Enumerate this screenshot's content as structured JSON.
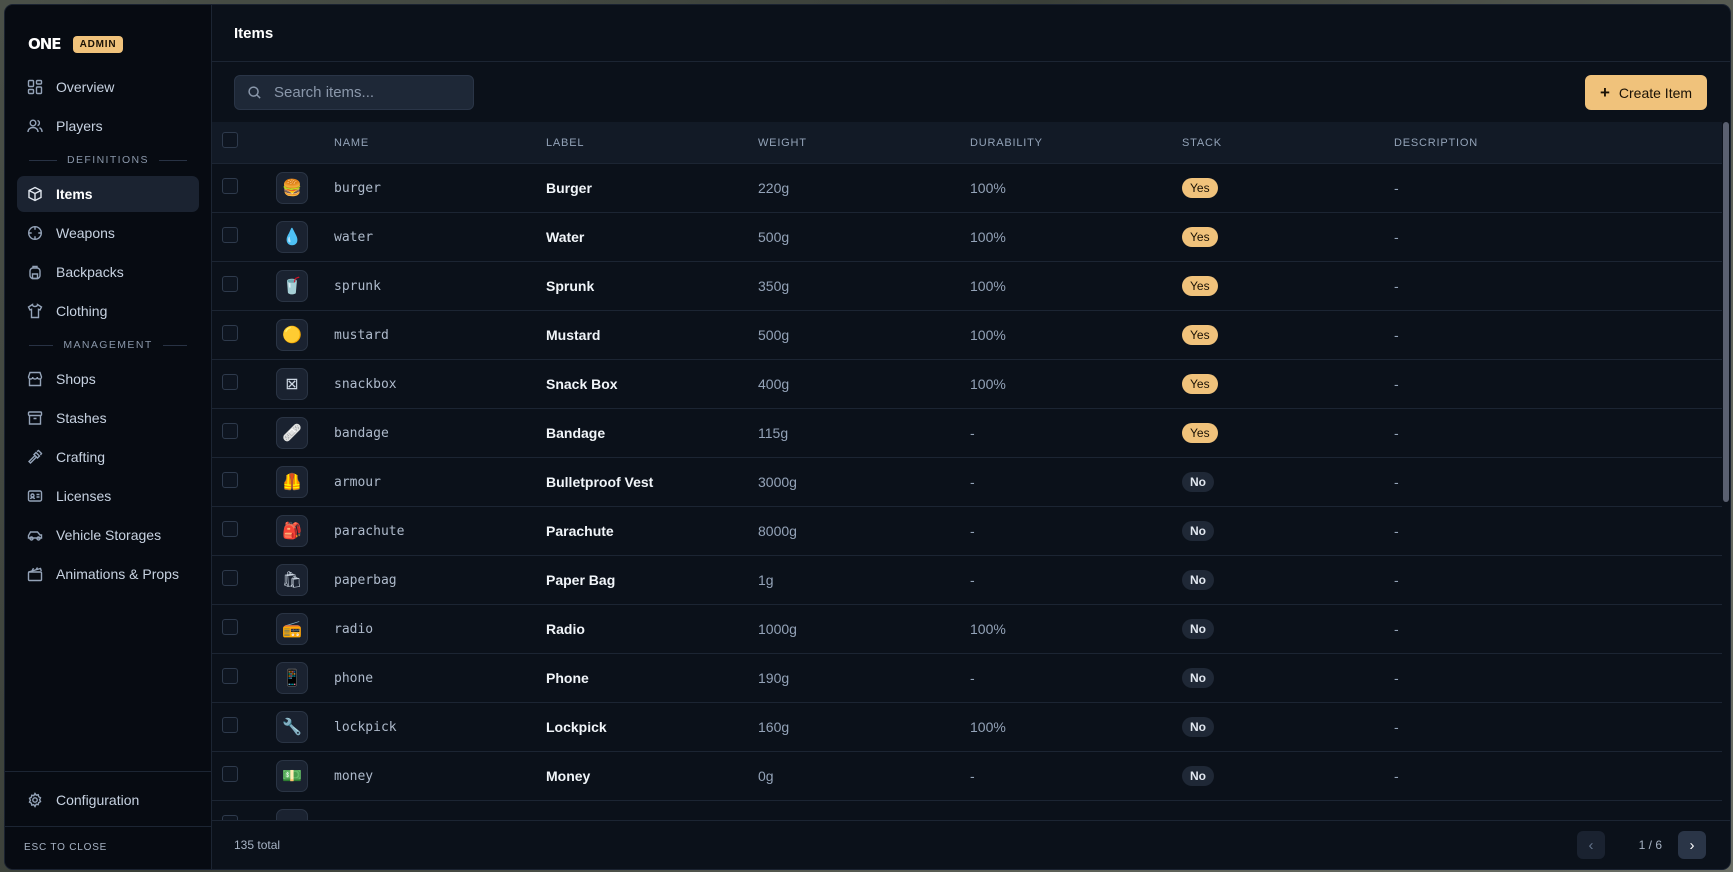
{
  "brand": {
    "logo": "ONE",
    "badge": "ADMIN"
  },
  "sidebar": {
    "items": [
      {
        "label": "Overview",
        "icon": "grid-icon"
      },
      {
        "label": "Players",
        "icon": "users-icon"
      }
    ],
    "definitions_label": "DEFINITIONS",
    "definitions": [
      {
        "label": "Items",
        "icon": "box-icon",
        "active": true
      },
      {
        "label": "Weapons",
        "icon": "crosshair-icon"
      },
      {
        "label": "Backpacks",
        "icon": "backpack-icon"
      },
      {
        "label": "Clothing",
        "icon": "shirt-icon"
      }
    ],
    "management_label": "MANAGEMENT",
    "management": [
      {
        "label": "Shops",
        "icon": "store-icon"
      },
      {
        "label": "Stashes",
        "icon": "archive-icon"
      },
      {
        "label": "Crafting",
        "icon": "hammer-icon"
      },
      {
        "label": "Licenses",
        "icon": "id-card-icon"
      },
      {
        "label": "Vehicle Storages",
        "icon": "car-icon"
      },
      {
        "label": "Animations & Props",
        "icon": "clapperboard-icon"
      }
    ],
    "configuration": "Configuration",
    "esc": "ESC TO CLOSE"
  },
  "header": {
    "title": "Items"
  },
  "search": {
    "placeholder": "Search items..."
  },
  "toolbar": {
    "create_label": "Create Item"
  },
  "table": {
    "columns": [
      "NAME",
      "LABEL",
      "WEIGHT",
      "DURABILITY",
      "STACK",
      "DESCRIPTION"
    ],
    "rows": [
      {
        "name": "burger",
        "label": "Burger",
        "weight": "220g",
        "durability": "100%",
        "stack": "Yes",
        "description": "-",
        "emoji": "🍔"
      },
      {
        "name": "water",
        "label": "Water",
        "weight": "500g",
        "durability": "100%",
        "stack": "Yes",
        "description": "-",
        "emoji": "💧"
      },
      {
        "name": "sprunk",
        "label": "Sprunk",
        "weight": "350g",
        "durability": "100%",
        "stack": "Yes",
        "description": "-",
        "emoji": "🥤"
      },
      {
        "name": "mustard",
        "label": "Mustard",
        "weight": "500g",
        "durability": "100%",
        "stack": "Yes",
        "description": "-",
        "emoji": "🟡"
      },
      {
        "name": "snackbox",
        "label": "Snack Box",
        "weight": "400g",
        "durability": "100%",
        "stack": "Yes",
        "description": "-",
        "emoji": "⊠"
      },
      {
        "name": "bandage",
        "label": "Bandage",
        "weight": "115g",
        "durability": "-",
        "stack": "Yes",
        "description": "-",
        "emoji": "🩹"
      },
      {
        "name": "armour",
        "label": "Bulletproof Vest",
        "weight": "3000g",
        "durability": "-",
        "stack": "No",
        "description": "-",
        "emoji": "🦺"
      },
      {
        "name": "parachute",
        "label": "Parachute",
        "weight": "8000g",
        "durability": "-",
        "stack": "No",
        "description": "-",
        "emoji": "🎒"
      },
      {
        "name": "paperbag",
        "label": "Paper Bag",
        "weight": "1g",
        "durability": "-",
        "stack": "No",
        "description": "-",
        "emoji": "🛍"
      },
      {
        "name": "radio",
        "label": "Radio",
        "weight": "1000g",
        "durability": "100%",
        "stack": "No",
        "description": "-",
        "emoji": "📻"
      },
      {
        "name": "phone",
        "label": "Phone",
        "weight": "190g",
        "durability": "-",
        "stack": "No",
        "description": "-",
        "emoji": "📱"
      },
      {
        "name": "lockpick",
        "label": "Lockpick",
        "weight": "160g",
        "durability": "100%",
        "stack": "No",
        "description": "-",
        "emoji": "🔧"
      },
      {
        "name": "money",
        "label": "Money",
        "weight": "0g",
        "durability": "-",
        "stack": "No",
        "description": "-",
        "emoji": "💵"
      },
      {
        "name": "",
        "label": "",
        "weight": "",
        "durability": "",
        "stack": "",
        "description": "",
        "emoji": ""
      }
    ]
  },
  "footer": {
    "total": "135 total",
    "page": "1 / 6"
  },
  "colors": {
    "accent": "#f0c27b",
    "background": "#0b111a",
    "sidebar": "#070b12"
  }
}
